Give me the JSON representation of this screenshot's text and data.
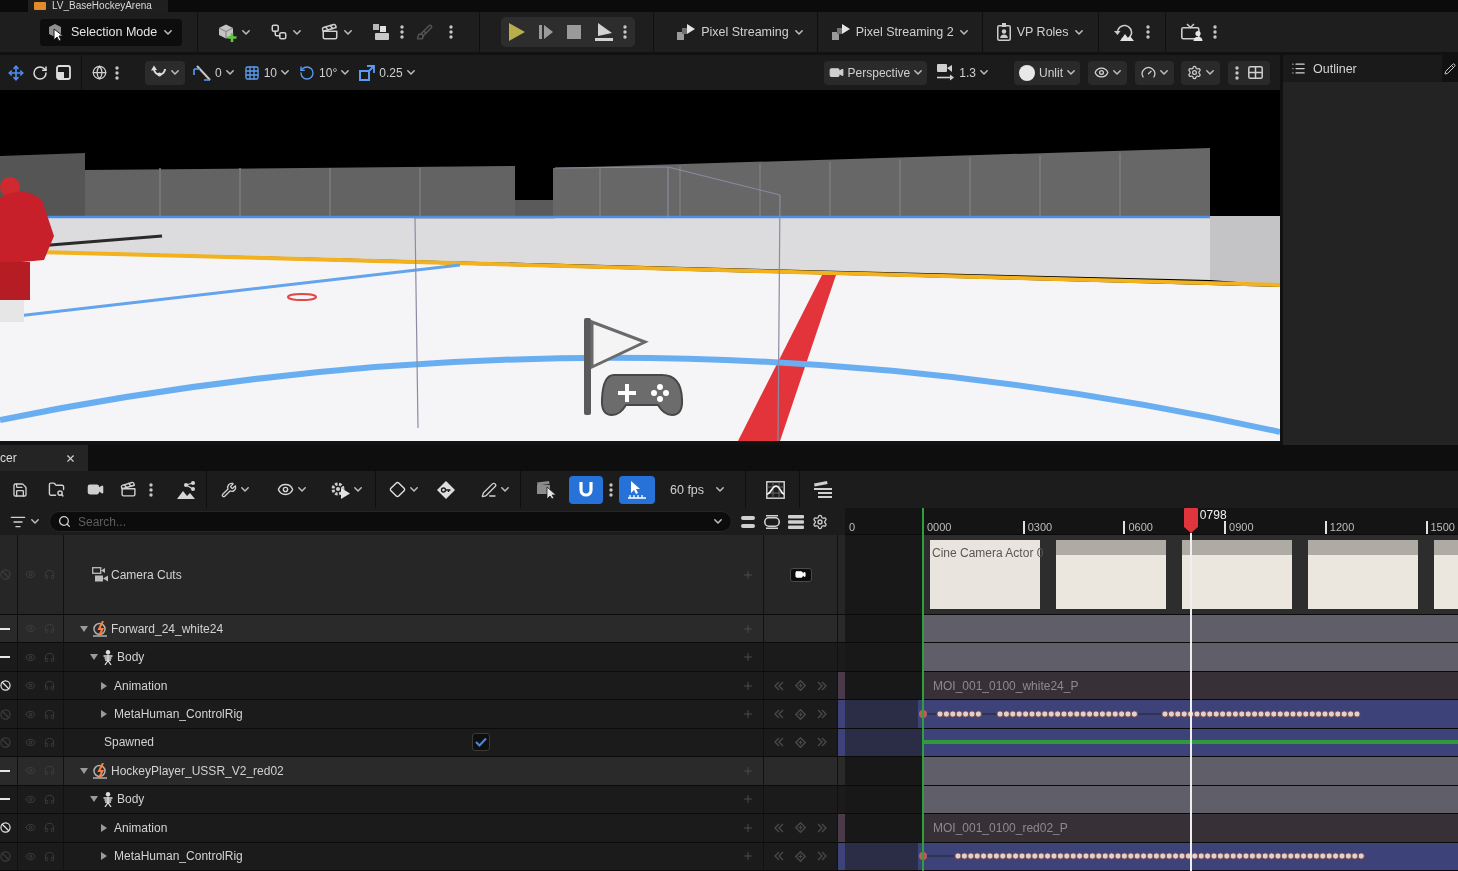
{
  "editor_tab": {
    "title": "LV_BaseHockeyArena"
  },
  "main_toolbar": {
    "mode_button": "Selection Mode",
    "menus": [
      {
        "kind": "streaming",
        "label": "Pixel Streaming"
      },
      {
        "kind": "streaming",
        "label": "Pixel Streaming 2"
      },
      {
        "kind": "roles",
        "label": "VP Roles"
      }
    ]
  },
  "viewport_toolbar": {
    "snaps": [
      {
        "kind": "angle",
        "value": "0"
      },
      {
        "kind": "grid",
        "value": "10"
      },
      {
        "kind": "rotation",
        "value": "10°"
      },
      {
        "kind": "scale",
        "value": "0.25"
      }
    ],
    "view_mode": "Perspective",
    "camera_speed": "1.3",
    "lighting": "Unlit"
  },
  "outliner": {
    "title": "Outliner"
  },
  "sequencer": {
    "tab": {
      "label": "cer"
    },
    "snap_on": true,
    "playhead_snap_on": true,
    "frame_rate": "60 fps",
    "search": {
      "placeholder": "Search..."
    },
    "ruler": {
      "ticks": [
        "0",
        "0000",
        "0300",
        "0600",
        "0900",
        "1200",
        "1500"
      ],
      "playhead": "0798"
    },
    "tracks": [
      {
        "kind": "camera-cuts",
        "label": "Camera Cuts",
        "marker": {
          "kind": "blocked",
          "active": false
        },
        "section": {
          "kind": "thumbnails",
          "label": "Cine Camera Actor 0"
        }
      },
      {
        "kind": "actor",
        "label": "Forward_24_white24",
        "expanded": true,
        "marker": {
          "kind": "dash",
          "active": true
        },
        "section": {
          "kind": "bar"
        },
        "children": [
          {
            "kind": "component",
            "label": "Body",
            "expanded": true,
            "marker": {
              "kind": "dash",
              "active": true
            },
            "section": {
              "kind": "bar"
            },
            "children": [
              {
                "kind": "channel",
                "label": "Animation",
                "expanded": false,
                "marker": {
                  "kind": "blocked",
                  "active": true
                },
                "section": {
                  "kind": "clip",
                  "label": "MOI_001_0100_white24_P"
                }
              },
              {
                "kind": "channel",
                "label": "MetaHuman_ControlRig",
                "expanded": false,
                "marker": {
                  "kind": "blocked",
                  "active": false
                },
                "section": {
                  "kind": "keys"
                }
              }
            ]
          },
          {
            "kind": "channel",
            "label": "Spawned",
            "checked": true,
            "marker": {
              "kind": "blocked",
              "active": false
            },
            "section": {
              "kind": "bool"
            }
          }
        ]
      },
      {
        "kind": "actor",
        "label": "HockeyPlayer_USSR_V2_red02",
        "expanded": true,
        "marker": {
          "kind": "dash",
          "active": true
        },
        "section": {
          "kind": "bar"
        },
        "children": [
          {
            "kind": "component",
            "label": "Body",
            "expanded": true,
            "marker": {
              "kind": "dash",
              "active": true
            },
            "section": {
              "kind": "bar"
            },
            "children": [
              {
                "kind": "channel",
                "label": "Animation",
                "expanded": false,
                "marker": {
                  "kind": "blocked",
                  "active": true
                },
                "section": {
                  "kind": "clip",
                  "label": "MOI_001_0100_red02_P"
                }
              },
              {
                "kind": "channel",
                "label": "MetaHuman_ControlRig",
                "expanded": false,
                "marker": {
                  "kind": "blocked",
                  "active": false
                },
                "section": {
                  "kind": "keys"
                }
              }
            ]
          }
        ]
      }
    ]
  }
}
